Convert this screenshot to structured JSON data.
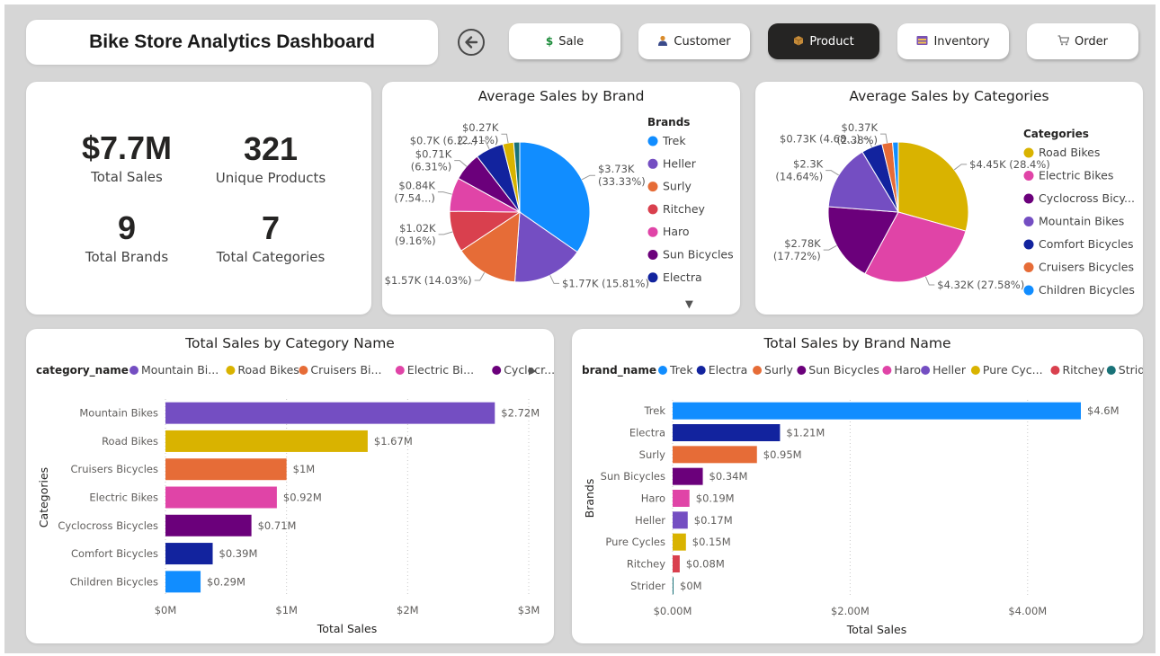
{
  "header": {
    "title": "Bike Store Analytics Dashboard",
    "nav": [
      {
        "label": "Sale",
        "icon": "dollar-icon",
        "glyph": "$",
        "glyph_color": "#1c8b3a",
        "active": false
      },
      {
        "label": "Customer",
        "icon": "person-icon",
        "glyph": "●",
        "glyph_color": "#d98b2b",
        "active": false
      },
      {
        "label": "Product",
        "icon": "box-icon",
        "glyph": "■",
        "glyph_color": "#c58b3a",
        "active": true
      },
      {
        "label": "Inventory",
        "icon": "inventory-icon",
        "glyph": "▬",
        "glyph_color": "#7a52b3",
        "active": false
      },
      {
        "label": "Order",
        "icon": "cart-icon",
        "glyph": "▼",
        "glyph_color": "#8a8a8a",
        "active": false
      }
    ]
  },
  "kpis": [
    {
      "value": "$7.7M",
      "label": "Total Sales"
    },
    {
      "value": "321",
      "label": "Unique Products"
    },
    {
      "value": "9",
      "label": "Total Brands"
    },
    {
      "value": "7",
      "label": "Total Categories"
    }
  ],
  "colors": {
    "Trek": "#118dff",
    "Heller": "#744ec2",
    "Surly": "#e66c37",
    "Ritchey": "#d9404e",
    "Haro": "#e044a7",
    "Sun Bicycles": "#6b007b",
    "Electra": "#12239e",
    "Pure Cycles": "#d9b300",
    "Strider": "#197278",
    "Road Bikes": "#d9b300",
    "Electric Bikes": "#e044a7",
    "Cyclocross Bicycles": "#6b007b",
    "Mountain Bikes": "#744ec2",
    "Comfort Bicycles": "#12239e",
    "Cruisers Bicycles": "#e66c37",
    "Children Bicycles": "#118dff"
  },
  "chart_data": [
    {
      "id": "avg_brand",
      "type": "pie",
      "title": "Average Sales by Brand",
      "legend_title": "Brands",
      "legend_items": [
        "Trek",
        "Heller",
        "Surly",
        "Ritchey",
        "Haro",
        "Sun Bicycles",
        "Electra"
      ],
      "legend_more": "▼",
      "slices": [
        {
          "name": "Trek",
          "value": 3730,
          "label1": "$3.73K",
          "label2": "(33.33%)"
        },
        {
          "name": "Heller",
          "value": 1770,
          "label1": "$1.77K (15.81%)",
          "label2": ""
        },
        {
          "name": "Surly",
          "value": 1570,
          "label1": "$1.57K (14.03%)",
          "label2": ""
        },
        {
          "name": "Ritchey",
          "value": 1020,
          "label1": "$1.02K",
          "label2": "(9.16%)"
        },
        {
          "name": "Haro",
          "value": 840,
          "label1": "$0.84K",
          "label2": "(7.54...)"
        },
        {
          "name": "Sun Bicycles",
          "value": 710,
          "label1": "$0.71K",
          "label2": "(6.31%)"
        },
        {
          "name": "Electra",
          "value": 700,
          "label1": "$0.7K (6.2...)",
          "label2": ""
        },
        {
          "name": "Pure Cycles",
          "value": 270,
          "label1": "$0.27K",
          "label2": "(2.41%)"
        },
        {
          "name": "Strider",
          "value": 150,
          "label1": "",
          "label2": ""
        }
      ]
    },
    {
      "id": "avg_cat",
      "type": "pie",
      "title": "Average Sales by Categories",
      "legend_title": "Categories",
      "legend_items": [
        "Road Bikes",
        "Electric Bikes",
        "Cyclocross Bicy...",
        "Mountain Bikes",
        "Comfort Bicycles",
        "Cruisers Bicycles",
        "Children Bicycles"
      ],
      "legend_keys": [
        "Road Bikes",
        "Electric Bikes",
        "Cyclocross Bicycles",
        "Mountain Bikes",
        "Comfort Bicycles",
        "Cruisers Bicycles",
        "Children Bicycles"
      ],
      "slices": [
        {
          "name": "Road Bikes",
          "value": 4450,
          "label1": "$4.45K (28.4%)",
          "label2": ""
        },
        {
          "name": "Electric Bikes",
          "value": 4320,
          "label1": "$4.32K (27.58%)",
          "label2": ""
        },
        {
          "name": "Cyclocross Bicycles",
          "value": 2780,
          "label1": "$2.78K",
          "label2": "(17.72%)"
        },
        {
          "name": "Mountain Bikes",
          "value": 2300,
          "label1": "$2.3K",
          "label2": "(14.64%)"
        },
        {
          "name": "Comfort Bicycles",
          "value": 730,
          "label1": "$0.73K (4.68...)",
          "label2": ""
        },
        {
          "name": "Cruisers Bicycles",
          "value": 370,
          "label1": "$0.37K",
          "label2": "(2.38%)"
        },
        {
          "name": "Children Bicycles",
          "value": 200,
          "label1": "",
          "label2": ""
        }
      ]
    },
    {
      "id": "cat_bar",
      "type": "bar",
      "orientation": "horizontal",
      "title": "Total Sales by Category Name",
      "legend_title": "category_name",
      "legend_items": [
        "Mountain Bi...",
        "Road Bikes",
        "Cruisers Bi...",
        "Electric Bi...",
        "Cyclocr..."
      ],
      "legend_keys": [
        "Mountain Bikes",
        "Road Bikes",
        "Cruisers Bicycles",
        "Electric Bikes",
        "Cyclocross Bicycles"
      ],
      "legend_more": "▶",
      "categories": [
        "Mountain Bikes",
        "Road Bikes",
        "Cruisers Bicycles",
        "Electric Bikes",
        "Cyclocross Bicycles",
        "Comfort Bicycles",
        "Children Bicycles"
      ],
      "values": [
        2.72,
        1.67,
        1.0,
        0.92,
        0.71,
        0.39,
        0.29
      ],
      "value_labels": [
        "$2.72M",
        "$1.67M",
        "$1M",
        "$0.92M",
        "$0.71M",
        "$0.39M",
        "$0.29M"
      ],
      "xlim": [
        0,
        3
      ],
      "ticks": [
        0,
        1,
        2,
        3
      ],
      "tick_labels": [
        "$0M",
        "$1M",
        "$2M",
        "$3M"
      ],
      "xlabel": "Total Sales",
      "ylabel": "Categories"
    },
    {
      "id": "brand_bar",
      "type": "bar",
      "orientation": "horizontal",
      "title": "Total Sales by Brand Name",
      "legend_title": "brand_name",
      "legend_items": [
        "Trek",
        "Electra",
        "Surly",
        "Sun Bicycles",
        "Haro",
        "Heller",
        "Pure Cyc...",
        "Ritchey",
        "Strider"
      ],
      "legend_keys": [
        "Trek",
        "Electra",
        "Surly",
        "Sun Bicycles",
        "Haro",
        "Heller",
        "Pure Cycles",
        "Ritchey",
        "Strider"
      ],
      "categories": [
        "Trek",
        "Electra",
        "Surly",
        "Sun Bicycles",
        "Haro",
        "Heller",
        "Pure Cycles",
        "Ritchey",
        "Strider"
      ],
      "values": [
        4.6,
        1.21,
        0.95,
        0.34,
        0.19,
        0.17,
        0.15,
        0.08,
        0.0
      ],
      "value_labels": [
        "$4.6M",
        "$1.21M",
        "$0.95M",
        "$0.34M",
        "$0.19M",
        "$0.17M",
        "$0.15M",
        "$0.08M",
        "$0M"
      ],
      "xlim": [
        0,
        4.6
      ],
      "ticks": [
        0,
        2,
        4
      ],
      "tick_labels": [
        "$0.00M",
        "$2.00M",
        "$4.00M"
      ],
      "xlabel": "Total Sales",
      "ylabel": "Brands"
    }
  ]
}
